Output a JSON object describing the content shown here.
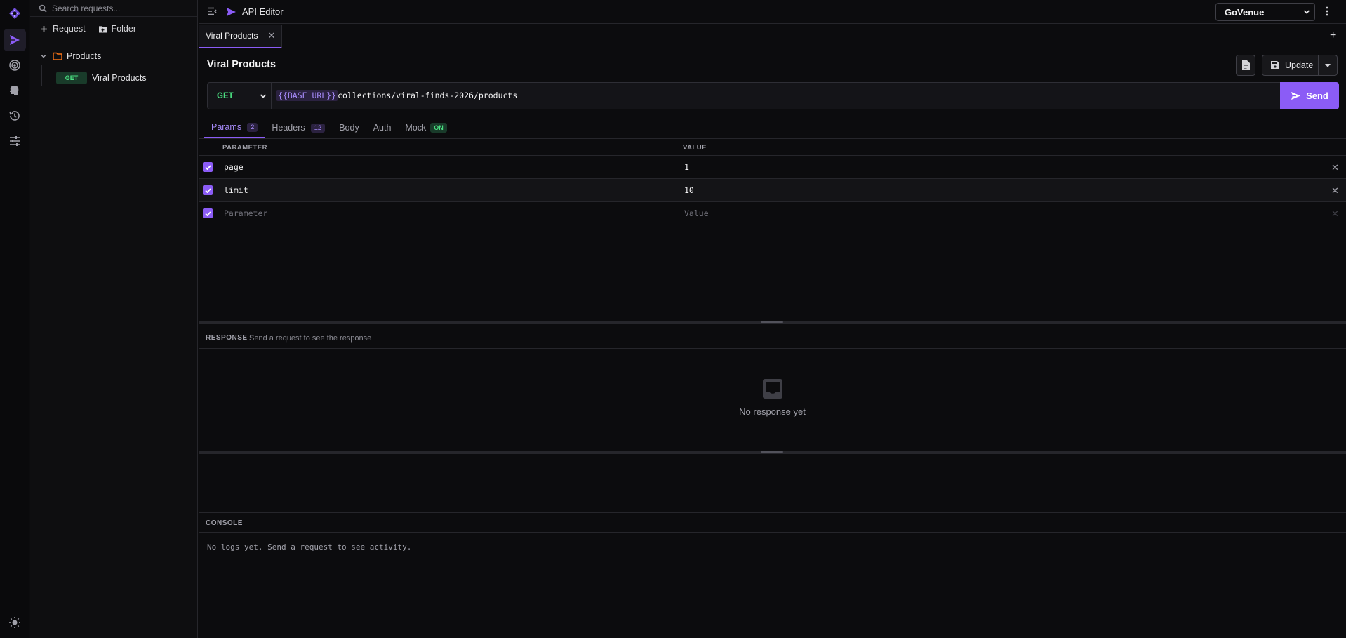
{
  "sidebar": {
    "search_placeholder": "Search requests...",
    "actions": {
      "request": "Request",
      "folder": "Folder"
    },
    "folder": {
      "name": "Products"
    },
    "item": {
      "method": "GET",
      "name": "Viral Products"
    }
  },
  "header": {
    "title": "API Editor",
    "environment": "GoVenue"
  },
  "tabs": [
    {
      "label": "Viral Products"
    }
  ],
  "request": {
    "title": "Viral Products",
    "update_label": "Update",
    "method": "GET",
    "url_var": "{{BASE_URL}}",
    "url_path": "collections/viral-finds-2026/products",
    "send_label": "Send"
  },
  "subtabs": {
    "params": {
      "label": "Params",
      "count": "2"
    },
    "headers": {
      "label": "Headers",
      "count": "12"
    },
    "body": {
      "label": "Body"
    },
    "auth": {
      "label": "Auth"
    },
    "mock": {
      "label": "Mock",
      "badge": "ON"
    }
  },
  "params": {
    "col_param": "PARAMETER",
    "col_value": "VALUE",
    "rows": [
      {
        "key": "page",
        "value": "1"
      },
      {
        "key": "limit",
        "value": "10"
      }
    ],
    "placeholder_key": "Parameter",
    "placeholder_value": "Value"
  },
  "response": {
    "label": "RESPONSE",
    "hint": "Send a request to see the response",
    "empty": "No response yet"
  },
  "console": {
    "label": "CONSOLE",
    "empty": "No logs yet. Send a request to see activity."
  },
  "colors": {
    "accent": "#8b5cf6",
    "get": "#4ade80",
    "folder": "#f97316"
  }
}
